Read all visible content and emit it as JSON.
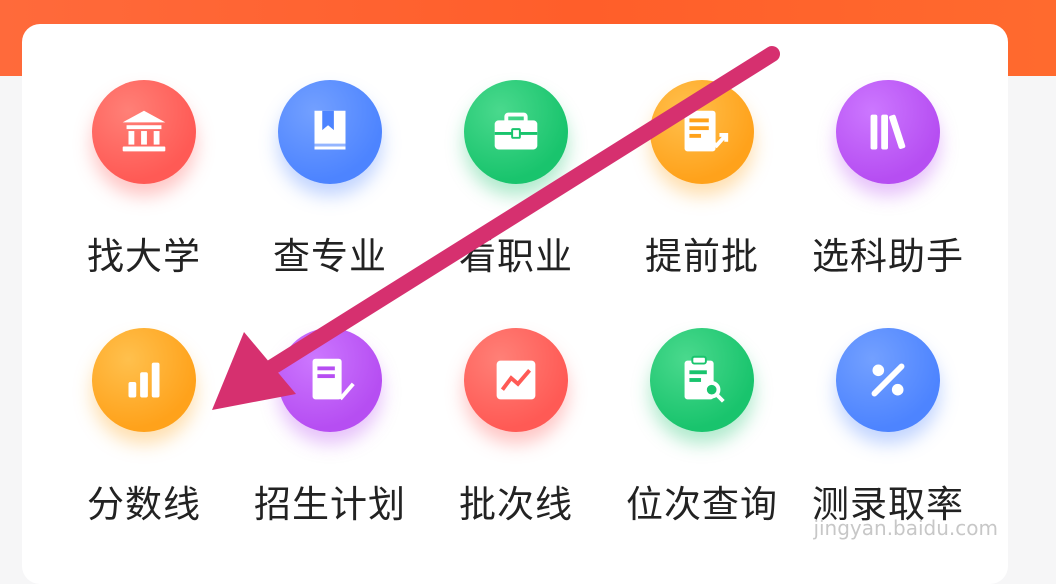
{
  "colors": {
    "header_orange": "#ff5e2a",
    "red": "#ff5a55",
    "blue": "#4d84ff",
    "green": "#19c46d",
    "orange": "#ffa21b",
    "purple": "#b64ef2",
    "annotation_arrow": "#d6306f"
  },
  "menu": {
    "row1": [
      {
        "label": "找大学",
        "icon": "university-icon"
      },
      {
        "label": "查专业",
        "icon": "book-icon"
      },
      {
        "label": "看职业",
        "icon": "briefcase-icon"
      },
      {
        "label": "提前批",
        "icon": "document-trend-icon"
      },
      {
        "label": "选科助手",
        "icon": "books-shelf-icon"
      }
    ],
    "row2": [
      {
        "label": "分数线",
        "icon": "bar-chart-icon"
      },
      {
        "label": "招生计划",
        "icon": "document-check-icon"
      },
      {
        "label": "批次线",
        "icon": "line-chart-icon"
      },
      {
        "label": "位次查询",
        "icon": "clipboard-search-icon"
      },
      {
        "label": "测录取率",
        "icon": "percent-icon"
      }
    ]
  },
  "watermark": "jingyan.baidu.com"
}
